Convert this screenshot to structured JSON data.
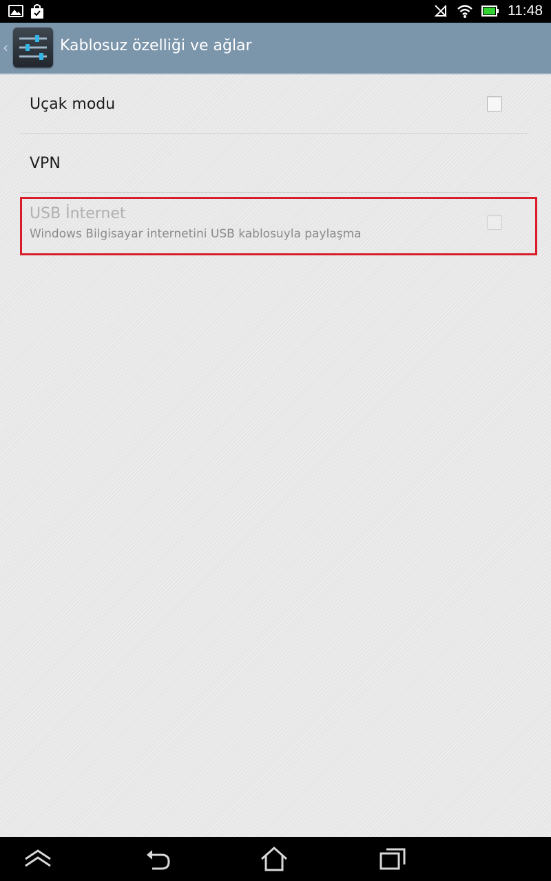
{
  "status_bar": {
    "time": "11:48",
    "icons_left": [
      "gallery-notification-icon",
      "shopping-bag-notification-icon"
    ],
    "icons_right": [
      "no-sync-icon",
      "wifi-icon",
      "battery-icon"
    ],
    "battery_color": "#32d232"
  },
  "action_bar": {
    "title": "Kablosuz özelliği ve ağlar",
    "background": "#7b95ab"
  },
  "preferences": [
    {
      "title": "Uçak modu",
      "checked": false,
      "enabled": true
    },
    {
      "title": "VPN",
      "enabled": true
    },
    {
      "title": "USB İnternet",
      "summary": "Windows Bilgisayar internetini USB kablosuyla paylaşma",
      "checked": false,
      "enabled": false,
      "highlighted": true
    }
  ],
  "highlight_color": "#d91c2a",
  "nav_bar": {
    "buttons": [
      "hide-keyboard-icon",
      "back-icon",
      "home-icon",
      "recent-apps-icon"
    ]
  }
}
